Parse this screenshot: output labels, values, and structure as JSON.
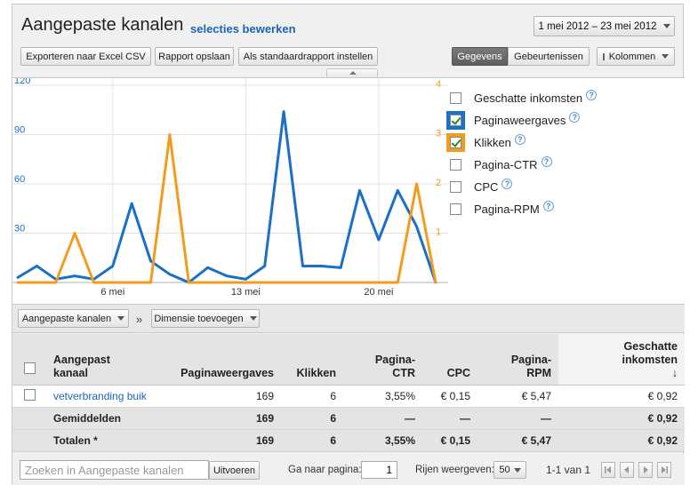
{
  "header": {
    "title": "Aangepaste kanalen",
    "edit_link": "selecties bewerken",
    "date_range": "1 mei 2012 – 23 mei 2012"
  },
  "toolbar": {
    "export_csv": "Exporteren naar Excel CSV",
    "save_report": "Rapport opslaan",
    "set_default": "Als standaardrapport instellen",
    "view_data": "Gegevens",
    "view_events": "Gebeurtenissen",
    "columns": "Kolommen"
  },
  "metrics": [
    {
      "label": "Geschatte inkomsten",
      "checked": false,
      "highlight": ""
    },
    {
      "label": "Paginaweergaves",
      "checked": true,
      "highlight": "#1a6fc9"
    },
    {
      "label": "Klikken",
      "checked": true,
      "highlight": "#f29c1f"
    },
    {
      "label": "Pagina-CTR",
      "checked": false,
      "highlight": ""
    },
    {
      "label": "CPC",
      "checked": false,
      "highlight": ""
    },
    {
      "label": "Pagina-RPM",
      "checked": false,
      "highlight": ""
    }
  ],
  "chart_data": {
    "type": "line",
    "x": [
      "1 mei",
      "2 mei",
      "3 mei",
      "4 mei",
      "5 mei",
      "6 mei",
      "7 mei",
      "8 mei",
      "9 mei",
      "10 mei",
      "11 mei",
      "12 mei",
      "13 mei",
      "14 mei",
      "15 mei",
      "16 mei",
      "17 mei",
      "18 mei",
      "19 mei",
      "20 mei",
      "21 mei",
      "22 mei",
      "23 mei"
    ],
    "x_ticks": [
      "6 mei",
      "13 mei",
      "20 mei"
    ],
    "x_tick_index": [
      5,
      12,
      19
    ],
    "y_left": {
      "ticks": [
        "120",
        "90",
        "60",
        "30"
      ],
      "tick_values": [
        120,
        90,
        60,
        30
      ],
      "max": 120,
      "color": "#1a6fc9"
    },
    "y_right": {
      "ticks": [
        "4",
        "3",
        "2",
        "1"
      ],
      "tick_values": [
        4,
        3,
        2,
        1
      ],
      "max": 4,
      "color": "#f29c1f"
    },
    "series": [
      {
        "name": "Paginaweergaves",
        "axis": "left",
        "color": "#1a6fc9",
        "values": [
          3,
          10,
          2,
          4,
          2,
          10,
          48,
          13,
          5,
          0,
          9,
          4,
          2,
          10,
          104,
          10,
          10,
          9,
          56,
          26,
          56,
          34,
          0
        ]
      },
      {
        "name": "Klikken",
        "axis": "right",
        "color": "#f29c1f",
        "values": [
          0,
          0,
          0,
          1,
          0,
          0,
          0,
          0,
          3,
          0,
          0,
          0,
          0,
          0,
          0,
          0,
          0,
          0,
          0,
          0,
          0,
          2,
          0
        ]
      }
    ],
    "grid": true
  },
  "toolbar2": {
    "dimension": "Aangepaste kanalen",
    "separator": "»",
    "add_dimension": "Dimensie toevoegen"
  },
  "table": {
    "headers": {
      "dim_line1": "Aangepast",
      "dim_line2": "kanaal",
      "views": "Paginaweergaves",
      "clicks": "Klikken",
      "ctr_line1": "Pagina-",
      "ctr_line2": "CTR",
      "cpc": "CPC",
      "rpm_line1": "Pagina-",
      "rpm_line2": "RPM",
      "earn_line1": "Geschatte",
      "earn_line2": "inkomsten",
      "sort_arrow": "↓"
    },
    "rows": [
      {
        "dim": "vetverbranding buik",
        "views": "169",
        "clicks": "6",
        "ctr": "3,55%",
        "cpc": "€ 0,15",
        "rpm": "€ 5,47",
        "earn": "€ 0,92"
      }
    ],
    "averages": {
      "label": "Gemiddelden",
      "views": "169",
      "clicks": "6",
      "ctr": "—",
      "cpc": "—",
      "rpm": "—",
      "earn": "€ 0,92"
    },
    "totals": {
      "label": "Totalen *",
      "views": "169",
      "clicks": "6",
      "ctr": "3,55%",
      "cpc": "€ 0,15",
      "rpm": "€ 5,47",
      "earn": "€ 0,92"
    }
  },
  "footer": {
    "search_placeholder": "Zoeken in Aangepaste kanalen",
    "search_button": "Uitvoeren",
    "goto_label": "Ga naar pagina:",
    "page_value": "1",
    "rows_label": "Rijen weergeven:",
    "rows_value": "50",
    "range_text": "1-1 van 1"
  }
}
